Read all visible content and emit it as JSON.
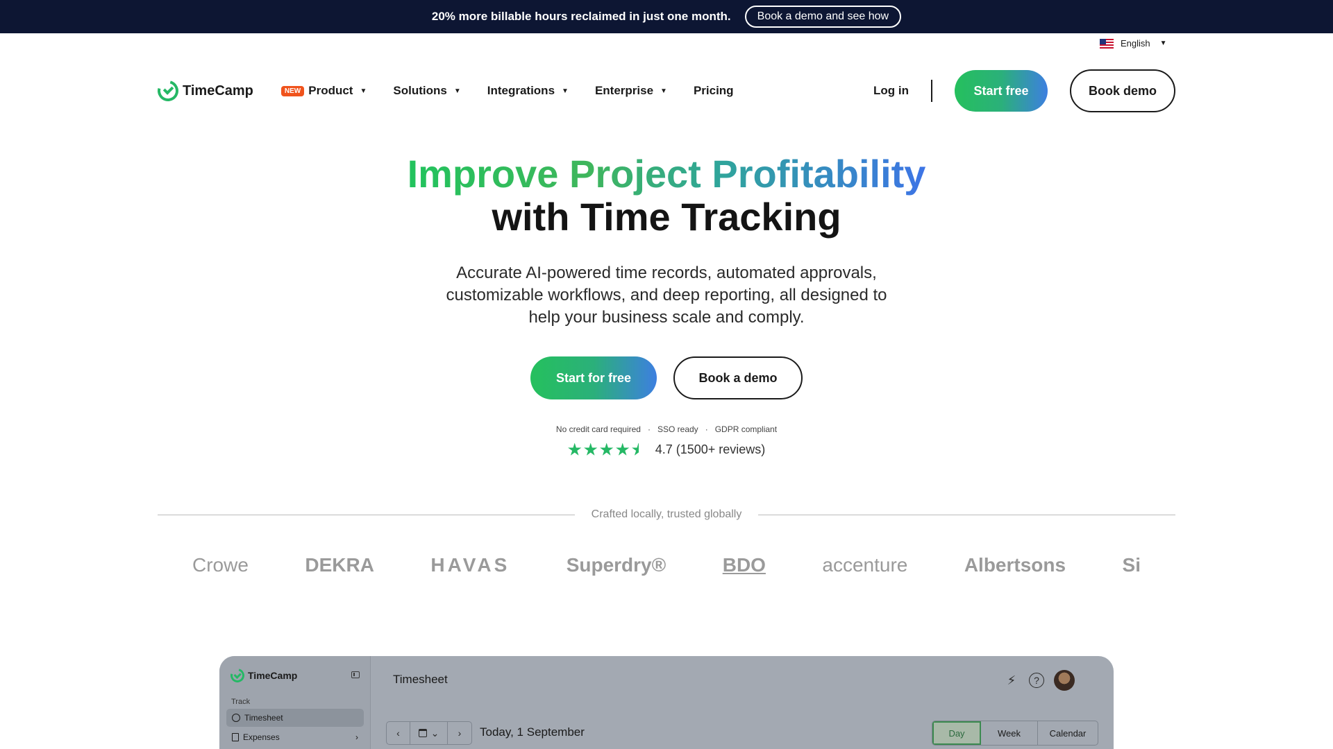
{
  "announcement": {
    "message": "20% more billable hours reclaimed in just one month.",
    "cta": "Book a demo and see how",
    "bg_color": "#0d1633"
  },
  "language": {
    "label": "English",
    "flag_icon": "us-flag-icon"
  },
  "nav": {
    "brand": "TimeCamp",
    "items": [
      {
        "label": "Product",
        "badge": "NEW",
        "has_dropdown": true
      },
      {
        "label": "Solutions",
        "has_dropdown": true
      },
      {
        "label": "Integrations",
        "has_dropdown": true
      },
      {
        "label": "Enterprise",
        "has_dropdown": true
      },
      {
        "label": "Pricing",
        "has_dropdown": false
      }
    ],
    "login": "Log in",
    "start": "Start free",
    "demo": "Book demo"
  },
  "hero": {
    "title_line1": "Improve Project Profitability",
    "title_line2": "with Time Tracking",
    "subtitle": "Accurate AI-powered time records, automated approvals, customizable workflows, and deep reporting, all designed to help your business scale and comply.",
    "start_button": "Start for free",
    "demo_button": "Book a demo",
    "fine_print": [
      "No credit card required",
      "SSO ready",
      "GDPR compliant"
    ],
    "fine_sep": "·",
    "rating_value": 4.5,
    "rating_text": "4.7 (1500+ reviews)"
  },
  "trusted": {
    "label": "Crafted locally, trusted globally",
    "logos": [
      "Crowe",
      "DEKRA",
      "HAVAS",
      "Superdry®",
      "BDO",
      "accenture",
      "Albertsons",
      "Si"
    ]
  },
  "app_preview": {
    "brand": "TimeCamp",
    "section_label": "Track",
    "sidebar_items": [
      {
        "label": "Timesheet",
        "icon": "clock-icon",
        "active": true
      },
      {
        "label": "Expenses",
        "icon": "receipt-icon",
        "active": false,
        "chevron": "›"
      }
    ],
    "title": "Timesheet",
    "date_label": "Today, 1 September",
    "nav_prev": "‹",
    "nav_next": "›",
    "view_tabs": [
      {
        "label": "Day",
        "active": true
      },
      {
        "label": "Week",
        "active": false
      },
      {
        "label": "Calendar",
        "active": false
      }
    ]
  },
  "colors": {
    "accent_green": "#25b865",
    "accent_blue": "#3d74e6",
    "badge_new": "#f0531c"
  }
}
